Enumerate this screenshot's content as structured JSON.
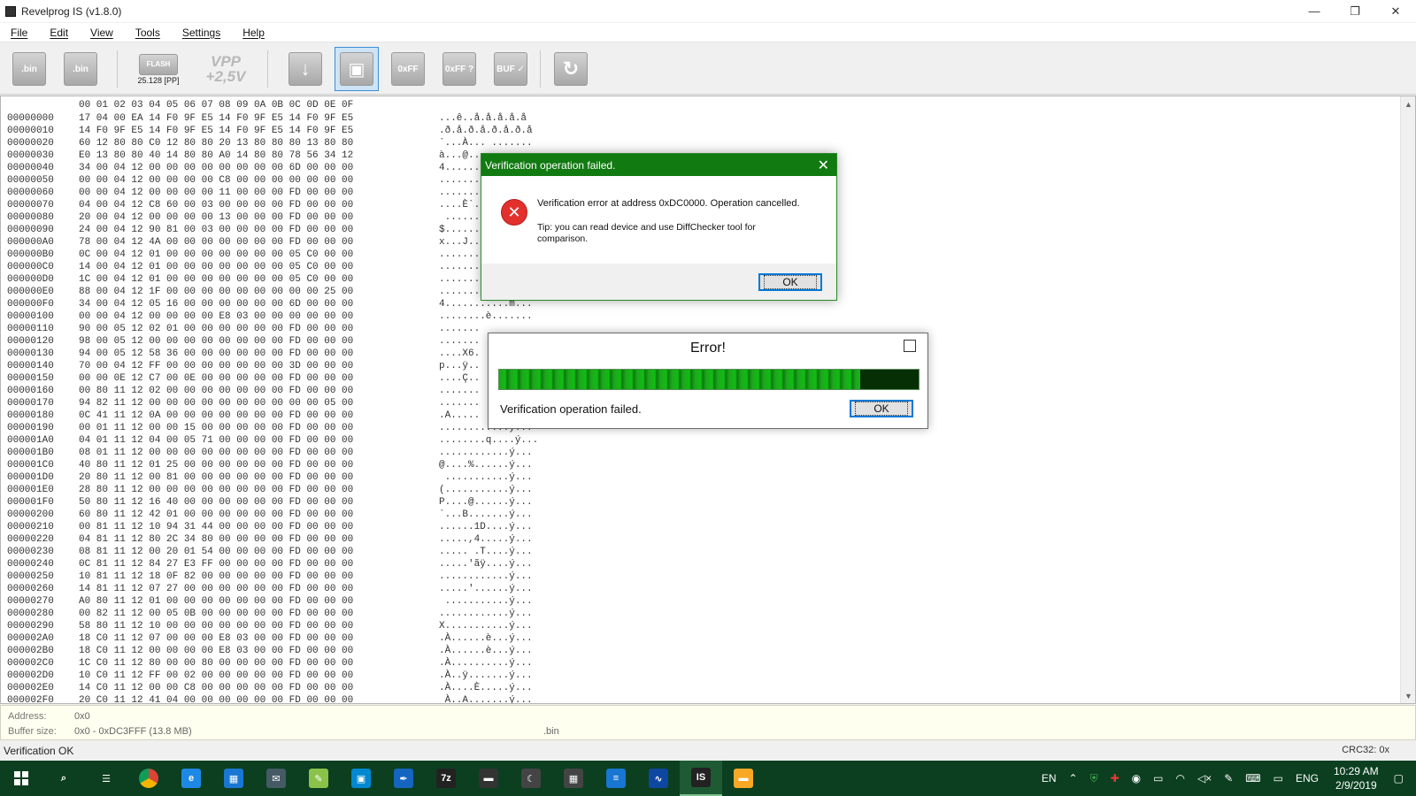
{
  "window": {
    "title": "Revelprog IS (v1.8.0)",
    "minimize": "—",
    "restore": "❐",
    "close": "✕"
  },
  "menu": [
    "File",
    "Edit",
    "View",
    "Tools",
    "Settings",
    "Help"
  ],
  "toolbar": {
    "open_caption": ".bin",
    "save_caption": ".bin",
    "chip_label": "FLASH",
    "chip_caption": "25.128 [PP]",
    "vpp_top": "VPP",
    "vpp_value": "+2,5V",
    "read_label": "↓",
    "write_label": "▣",
    "erase_label": "0xFF",
    "blank_label": "0xFF ?",
    "verify_label": "BUF ✓",
    "convert_label": "↻"
  },
  "hex": {
    "header": "00 01 02 03 04 05 06 07 08 09 0A 0B 0C 0D 0E 0F",
    "rows": [
      {
        "addr": "00000000",
        "bytes": "17 04 00 EA 14 F0 9F E5 14 F0 9F E5 14 F0 9F E5",
        "ascii": "...ê..å.å.å.å.å"
      },
      {
        "addr": "00000010",
        "bytes": "14 F0 9F E5 14 F0 9F E5 14 F0 9F E5 14 F0 9F E5",
        "ascii": ".ð.å.ð.å.ð.å.ð.å"
      },
      {
        "addr": "00000020",
        "bytes": "60 12 80 80 C0 12 80 80 20 13 80 80 80 13 80 80",
        "ascii": "`...À... ......."
      },
      {
        "addr": "00000030",
        "bytes": "E0 13 80 80 40 14 80 80 A0 14 80 80 78 56 34 12",
        "ascii": "à...@..."
      },
      {
        "addr": "00000040",
        "bytes": "34 00 04 12 00 00 00 00 00 00 00 00 6D 00 00 00",
        "ascii": "4......"
      },
      {
        "addr": "00000050",
        "bytes": "00 00 04 12 00 00 00 00 C8 00 00 00 00 00 00 00",
        "ascii": "......."
      },
      {
        "addr": "00000060",
        "bytes": "00 00 04 12 00 00 00 00 11 00 00 00 FD 00 00 00",
        "ascii": "......."
      },
      {
        "addr": "00000070",
        "bytes": "04 00 04 12 C8 60 00 03 00 00 00 00 FD 00 00 00",
        "ascii": "....È`."
      },
      {
        "addr": "00000080",
        "bytes": "20 00 04 12 00 00 00 00 13 00 00 00 FD 00 00 00",
        "ascii": " ......"
      },
      {
        "addr": "00000090",
        "bytes": "24 00 04 12 90 81 00 03 00 00 00 00 FD 00 00 00",
        "ascii": "$......"
      },
      {
        "addr": "000000A0",
        "bytes": "78 00 04 12 4A 00 00 00 00 00 00 00 FD 00 00 00",
        "ascii": "x...J.."
      },
      {
        "addr": "000000B0",
        "bytes": "0C 00 04 12 01 00 00 00 00 00 00 00 05 C0 00 00",
        "ascii": "......."
      },
      {
        "addr": "000000C0",
        "bytes": "14 00 04 12 01 00 00 00 00 00 00 00 05 C0 00 00",
        "ascii": "......."
      },
      {
        "addr": "000000D0",
        "bytes": "1C 00 04 12 01 00 00 00 00 00 00 00 05 C0 00 00",
        "ascii": "......."
      },
      {
        "addr": "000000E0",
        "bytes": "88 00 04 12 1F 00 00 00 00 00 00 00 00 00 25 00",
        "ascii": "......."
      },
      {
        "addr": "000000F0",
        "bytes": "34 00 04 12 05 16 00 00 00 00 00 00 6D 00 00 00",
        "ascii": "4...........m..."
      },
      {
        "addr": "00000100",
        "bytes": "00 00 04 12 00 00 00 00 E8 03 00 00 00 00 00 00",
        "ascii": "........è......."
      },
      {
        "addr": "00000110",
        "bytes": "90 00 05 12 02 01 00 00 00 00 00 00 FD 00 00 00",
        "ascii": "......."
      },
      {
        "addr": "00000120",
        "bytes": "98 00 05 12 00 00 00 00 00 00 00 00 FD 00 00 00",
        "ascii": "......."
      },
      {
        "addr": "00000130",
        "bytes": "94 00 05 12 58 36 00 00 00 00 00 00 FD 00 00 00",
        "ascii": "....X6."
      },
      {
        "addr": "00000140",
        "bytes": "70 00 04 12 FF 00 00 00 00 00 00 00 3D 00 00 00",
        "ascii": "p...ÿ.."
      },
      {
        "addr": "00000150",
        "bytes": "00 00 0E 12 C7 00 0E 00 00 00 00 00 FD 00 00 00",
        "ascii": "....Ç.."
      },
      {
        "addr": "00000160",
        "bytes": "00 80 11 12 02 00 00 00 00 00 00 00 FD 00 00 00",
        "ascii": "......."
      },
      {
        "addr": "00000170",
        "bytes": "94 82 11 12 00 00 00 00 00 00 00 00 00 00 05 00",
        "ascii": "......."
      },
      {
        "addr": "00000180",
        "bytes": "0C 41 11 12 0A 00 00 00 00 00 00 00 FD 00 00 00",
        "ascii": ".A....."
      },
      {
        "addr": "00000190",
        "bytes": "00 01 11 12 00 00 15 00 00 00 00 00 FD 00 00 00",
        "ascii": "............ý..."
      },
      {
        "addr": "000001A0",
        "bytes": "04 01 11 12 04 00 05 71 00 00 00 00 FD 00 00 00",
        "ascii": "........q....ý..."
      },
      {
        "addr": "000001B0",
        "bytes": "08 01 11 12 00 00 00 00 00 00 00 00 FD 00 00 00",
        "ascii": "............ý..."
      },
      {
        "addr": "000001C0",
        "bytes": "40 80 11 12 01 25 00 00 00 00 00 00 FD 00 00 00",
        "ascii": "@....%......ý..."
      },
      {
        "addr": "000001D0",
        "bytes": "20 80 11 12 00 81 00 00 00 00 00 00 FD 00 00 00",
        "ascii": " ...........ý..."
      },
      {
        "addr": "000001E0",
        "bytes": "28 80 11 12 00 00 00 00 00 00 00 00 FD 00 00 00",
        "ascii": "(...........ý..."
      },
      {
        "addr": "000001F0",
        "bytes": "50 80 11 12 16 40 00 00 00 00 00 00 FD 00 00 00",
        "ascii": "P....@......ý..."
      },
      {
        "addr": "00000200",
        "bytes": "60 80 11 12 42 01 00 00 00 00 00 00 FD 00 00 00",
        "ascii": "`...B.......ý..."
      },
      {
        "addr": "00000210",
        "bytes": "00 81 11 12 10 94 31 44 00 00 00 00 FD 00 00 00",
        "ascii": "......1D....ý..."
      },
      {
        "addr": "00000220",
        "bytes": "04 81 11 12 80 2C 34 80 00 00 00 00 FD 00 00 00",
        "ascii": ".....,4.....ý..."
      },
      {
        "addr": "00000230",
        "bytes": "08 81 11 12 00 20 01 54 00 00 00 00 FD 00 00 00",
        "ascii": "..... .T....ý..."
      },
      {
        "addr": "00000240",
        "bytes": "0C 81 11 12 84 27 E3 FF 00 00 00 00 FD 00 00 00",
        "ascii": ".....'ãÿ....ý..."
      },
      {
        "addr": "00000250",
        "bytes": "10 81 11 12 18 0F 82 00 00 00 00 00 FD 00 00 00",
        "ascii": "............ý..."
      },
      {
        "addr": "00000260",
        "bytes": "14 81 11 12 07 27 00 00 00 00 00 00 FD 00 00 00",
        "ascii": ".....'......ý..."
      },
      {
        "addr": "00000270",
        "bytes": "A0 80 11 12 01 00 00 00 00 00 00 00 FD 00 00 00",
        "ascii": " ...........ý..."
      },
      {
        "addr": "00000280",
        "bytes": "00 82 11 12 00 05 0B 00 00 00 00 00 FD 00 00 00",
        "ascii": "............ý..."
      },
      {
        "addr": "00000290",
        "bytes": "58 80 11 12 10 00 00 00 00 00 00 00 FD 00 00 00",
        "ascii": "X...........ý..."
      },
      {
        "addr": "000002A0",
        "bytes": "18 C0 11 12 07 00 00 00 E8 03 00 00 FD 00 00 00",
        "ascii": ".À......è...ý..."
      },
      {
        "addr": "000002B0",
        "bytes": "18 C0 11 12 00 00 00 00 E8 03 00 00 FD 00 00 00",
        "ascii": ".À......è...ý..."
      },
      {
        "addr": "000002C0",
        "bytes": "1C C0 11 12 80 00 00 80 00 00 00 00 FD 00 00 00",
        "ascii": ".À..........ý..."
      },
      {
        "addr": "000002D0",
        "bytes": "10 C0 11 12 FF 00 02 00 00 00 00 00 FD 00 00 00",
        "ascii": ".À..ÿ.......ý..."
      },
      {
        "addr": "000002E0",
        "bytes": "14 C0 11 12 00 00 C8 00 00 00 00 00 FD 00 00 00",
        "ascii": ".À....È.....ý..."
      },
      {
        "addr": "000002F0",
        "bytes": "20 C0 11 12 41 04 00 00 00 00 00 00 FD 00 00 00",
        "ascii": " À..A.......ý..."
      }
    ]
  },
  "info": {
    "address_label": "Address:",
    "address_value": "0x0",
    "buffer_label": "Buffer size:",
    "buffer_value": "0x0 - 0xDC3FFF (13.8 MB)",
    "file_ext": ".bin"
  },
  "status": {
    "text": "Verification OK",
    "crc": "CRC32: 0x"
  },
  "dialog_verify": {
    "title": "Verification operation failed.",
    "message": "Verification error at address 0xDC0000. Operation cancelled.",
    "tip": "Tip: you can read device and use DiffChecker tool for comparison.",
    "ok": "OK"
  },
  "dialog_error": {
    "title": "Error!",
    "progress": 0.86,
    "message": "Verification operation failed.",
    "ok": "OK"
  },
  "taskbar": {
    "apps": [
      {
        "name": "search-icon",
        "label": "⌕"
      },
      {
        "name": "task-view-icon",
        "label": "☰"
      },
      {
        "name": "chrome-icon",
        "label": "",
        "color": "#db4437"
      },
      {
        "name": "edge-icon",
        "label": "e",
        "color": "#1e88e5"
      },
      {
        "name": "store-icon",
        "label": "▦",
        "color": "#1976d2"
      },
      {
        "name": "mail-icon",
        "label": "✉",
        "color": "#455a64"
      },
      {
        "name": "paint-icon",
        "label": "✎",
        "color": "#8bc34a"
      },
      {
        "name": "calendar-icon",
        "label": "▣",
        "color": "#0288d1"
      },
      {
        "name": "pen-icon",
        "label": "✒",
        "color": "#1565c0"
      },
      {
        "name": "7zip-icon",
        "label": "7z",
        "color": "#222222"
      },
      {
        "name": "chip-app-icon",
        "label": "▬",
        "color": "#333333"
      },
      {
        "name": "moon-icon",
        "label": "☾",
        "color": "#444444"
      },
      {
        "name": "calculator-icon",
        "label": "▦",
        "color": "#444444"
      },
      {
        "name": "notes-icon",
        "label": "≡",
        "color": "#1976d2"
      },
      {
        "name": "monitor-icon",
        "label": "∿",
        "color": "#0d47a1"
      },
      {
        "name": "revelprog-icon",
        "label": "IS",
        "color": "#222222"
      },
      {
        "name": "folder-icon",
        "label": "▬",
        "color": "#f9a825"
      }
    ],
    "lang_short": "EN",
    "lang": "ENG",
    "time": "10:29 AM",
    "date": "2/9/2019"
  }
}
